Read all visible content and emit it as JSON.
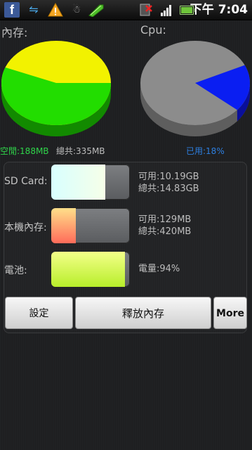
{
  "status_bar": {
    "icons": [
      "facebook-icon",
      "usb-icon",
      "warning-icon",
      "android-debug-icon",
      "pencil-icon",
      "no-sim-icon",
      "signal-icon",
      "battery-icon"
    ],
    "facebook_glyph": "f",
    "time": "下午 7:04"
  },
  "memory": {
    "title": "內存:",
    "free_label": "空閒:188MB",
    "total_label": "總共:335MB",
    "free_fraction": 0.56,
    "colors": {
      "free": "#22dd00",
      "used": "#f2f200",
      "free_side": "#128a00"
    }
  },
  "cpu": {
    "title": "Cpu:",
    "used_label": "已用:18%",
    "used_fraction": 0.18,
    "colors": {
      "used": "#0a1ef2",
      "idle": "#8c8c8c"
    }
  },
  "storage": {
    "sd_card": {
      "label": "SD Card:",
      "available": "可用:10.19GB",
      "total": "總共:14.83GB",
      "used_fraction": 0.69
    },
    "internal": {
      "label": "本機內存:",
      "available": "可用:129MB",
      "total": "總共:420MB",
      "used_fraction": 0.31
    },
    "battery": {
      "label": "電池:",
      "level": "電量:94%",
      "level_fraction": 0.94
    }
  },
  "buttons": {
    "settings": "設定",
    "release": "釋放內存",
    "more": "More"
  }
}
